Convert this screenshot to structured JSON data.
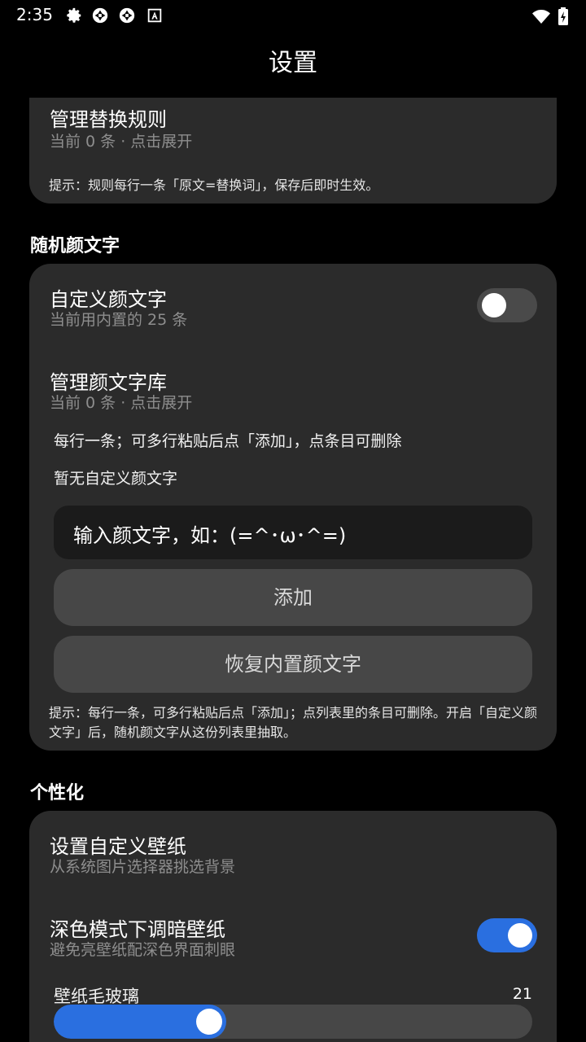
{
  "status_bar": {
    "time": "2:35",
    "icons": [
      "gear-icon",
      "aperture-icon",
      "aperture-icon",
      "font-a-icon"
    ],
    "right_icons": [
      "wifi-icon",
      "battery-charging-icon"
    ]
  },
  "app_title": "设置",
  "sections": {
    "replace_rules": {
      "manage_title": "管理替换规则",
      "manage_sub": "当前 0 条 · 点击展开",
      "hint": "提示：规则每行一条「原文=替换词」，保存后即时生效。"
    },
    "emoticons": {
      "header": "随机颜文字",
      "custom_title": "自定义颜文字",
      "custom_sub": "当前用内置的 25 条",
      "custom_enabled": false,
      "library_title": "管理颜文字库",
      "library_sub": "当前 0 条 · 点击展开",
      "instructions": "每行一条；可多行粘贴后点「添加」，点条目可删除",
      "empty_text": "暂无自定义颜文字",
      "input_placeholder": "输入颜文字，如：(=^･ω･^=)",
      "add_label": "添加",
      "restore_label": "恢复内置颜文字",
      "hint": "提示：每行一条，可多行粘贴后点「添加」；点列表里的条目可删除。开启「自定义颜文字」后，随机颜文字从这份列表里抽取。"
    },
    "personalization": {
      "header": "个性化",
      "wallpaper_title": "设置自定义壁纸",
      "wallpaper_sub": "从系统图片选择器挑选背景",
      "dim_title": "深色模式下调暗壁纸",
      "dim_sub": "避免亮壁纸配深色界面刺眼",
      "dim_enabled": true,
      "blur_label": "壁纸毛玻璃",
      "blur_value": "21",
      "blur_fraction": 0.36
    }
  },
  "colors": {
    "accent": "#2a6fe0",
    "card": "#2b2b2b",
    "background": "#000000"
  }
}
